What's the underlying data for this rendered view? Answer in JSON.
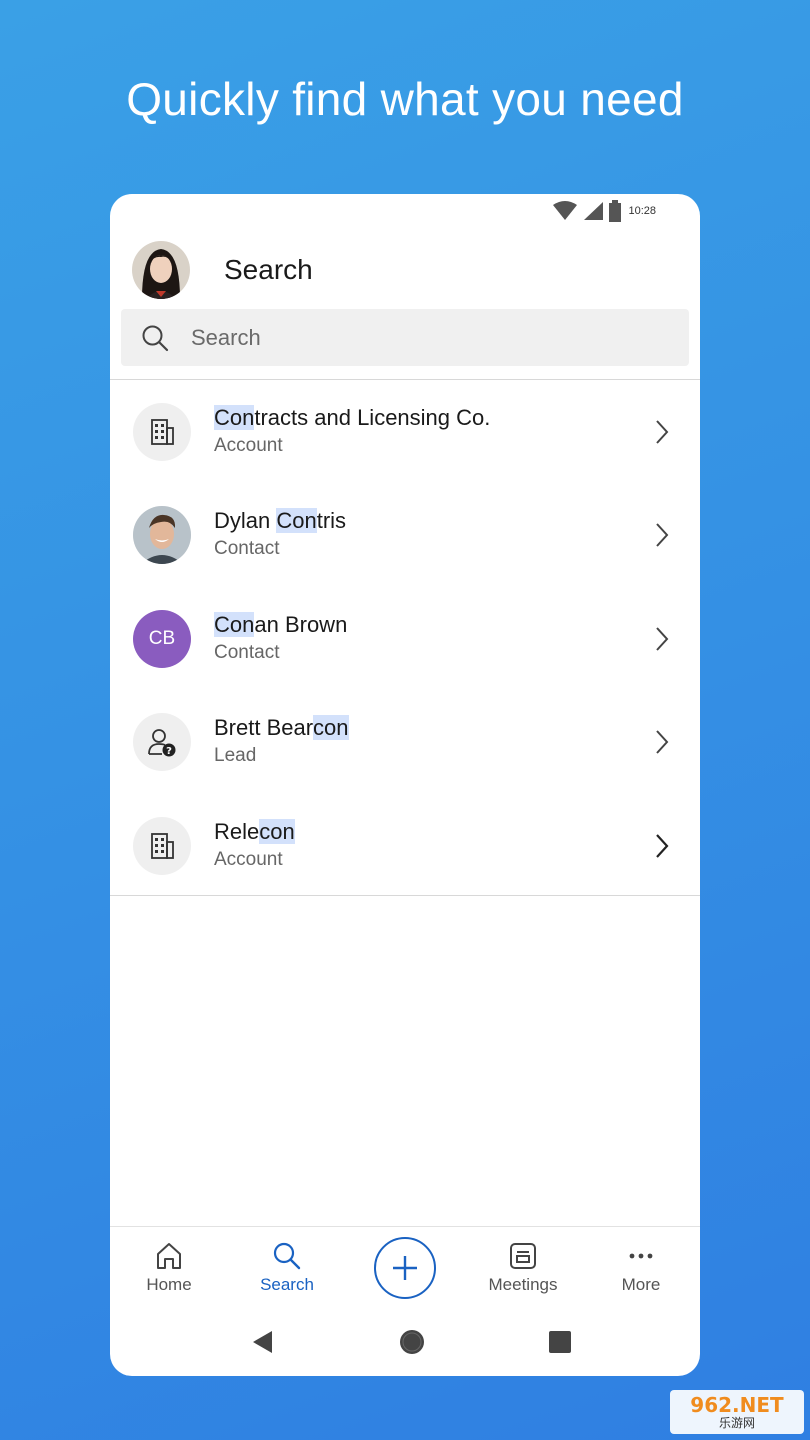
{
  "headline": "Quickly find what you need",
  "status_bar": {
    "time": "10:28"
  },
  "header": {
    "title": "Search"
  },
  "search": {
    "placeholder": "Search",
    "value": ""
  },
  "results": [
    {
      "name_hl": "Con",
      "name_rest": "tracts and Licensing Co.",
      "type": "Account",
      "icon": "building-icon"
    },
    {
      "name_pre": "Dylan ",
      "name_hl": "Con",
      "name_rest": "tris",
      "type": "Contact",
      "icon": "photo-avatar"
    },
    {
      "initials": "CB",
      "name_hl": "Con",
      "name_rest": "an Brown",
      "type": "Contact",
      "icon": "initials-avatar",
      "color": "#8a5cbf"
    },
    {
      "name_pre": "Brett Bear",
      "name_hl": "con",
      "type": "Lead",
      "icon": "lead-icon"
    },
    {
      "name_pre": "Rele",
      "name_hl": "con",
      "type": "Account",
      "icon": "building-icon"
    }
  ],
  "bottom_nav": {
    "home": "Home",
    "search": "Search",
    "meetings": "Meetings",
    "more": "More"
  },
  "watermark": {
    "top": "962.NET",
    "bottom": "乐游网"
  },
  "colors": {
    "accent": "#1a62c2",
    "highlight": "#d3e1fb",
    "background": "#3592e4"
  }
}
